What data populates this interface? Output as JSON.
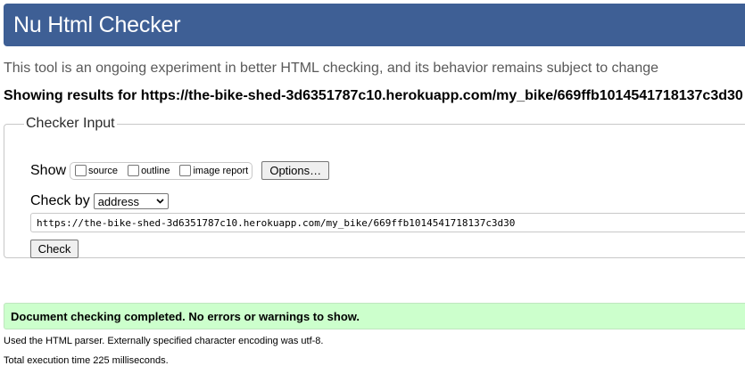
{
  "header": {
    "title": "Nu Html Checker"
  },
  "tagline": "This tool is an ongoing experiment in better HTML checking, and its behavior remains subject to change",
  "showing": "Showing results for https://the-bike-shed-3d6351787c10.herokuapp.com/my_bike/669ffb1014541718137c3d30",
  "checker_input": {
    "legend": "Checker Input",
    "show_label": "Show",
    "show_options": [
      {
        "label": "source",
        "checked": false
      },
      {
        "label": "outline",
        "checked": false
      },
      {
        "label": "image report",
        "checked": false
      }
    ],
    "options_button": "Options…",
    "check_by_label": "Check by",
    "check_by_value": "address",
    "url_value": "https://the-bike-shed-3d6351787c10.herokuapp.com/my_bike/669ffb1014541718137c3d30",
    "check_button": "Check"
  },
  "result": {
    "message": "Document checking completed. No errors or warnings to show.",
    "parser_note": "Used the HTML parser. Externally specified character encoding was utf-8.",
    "execution_time": "Total execution time 225 milliseconds."
  },
  "colors": {
    "header_bg": "#3e5f95",
    "success_bg": "#ccffcc"
  }
}
